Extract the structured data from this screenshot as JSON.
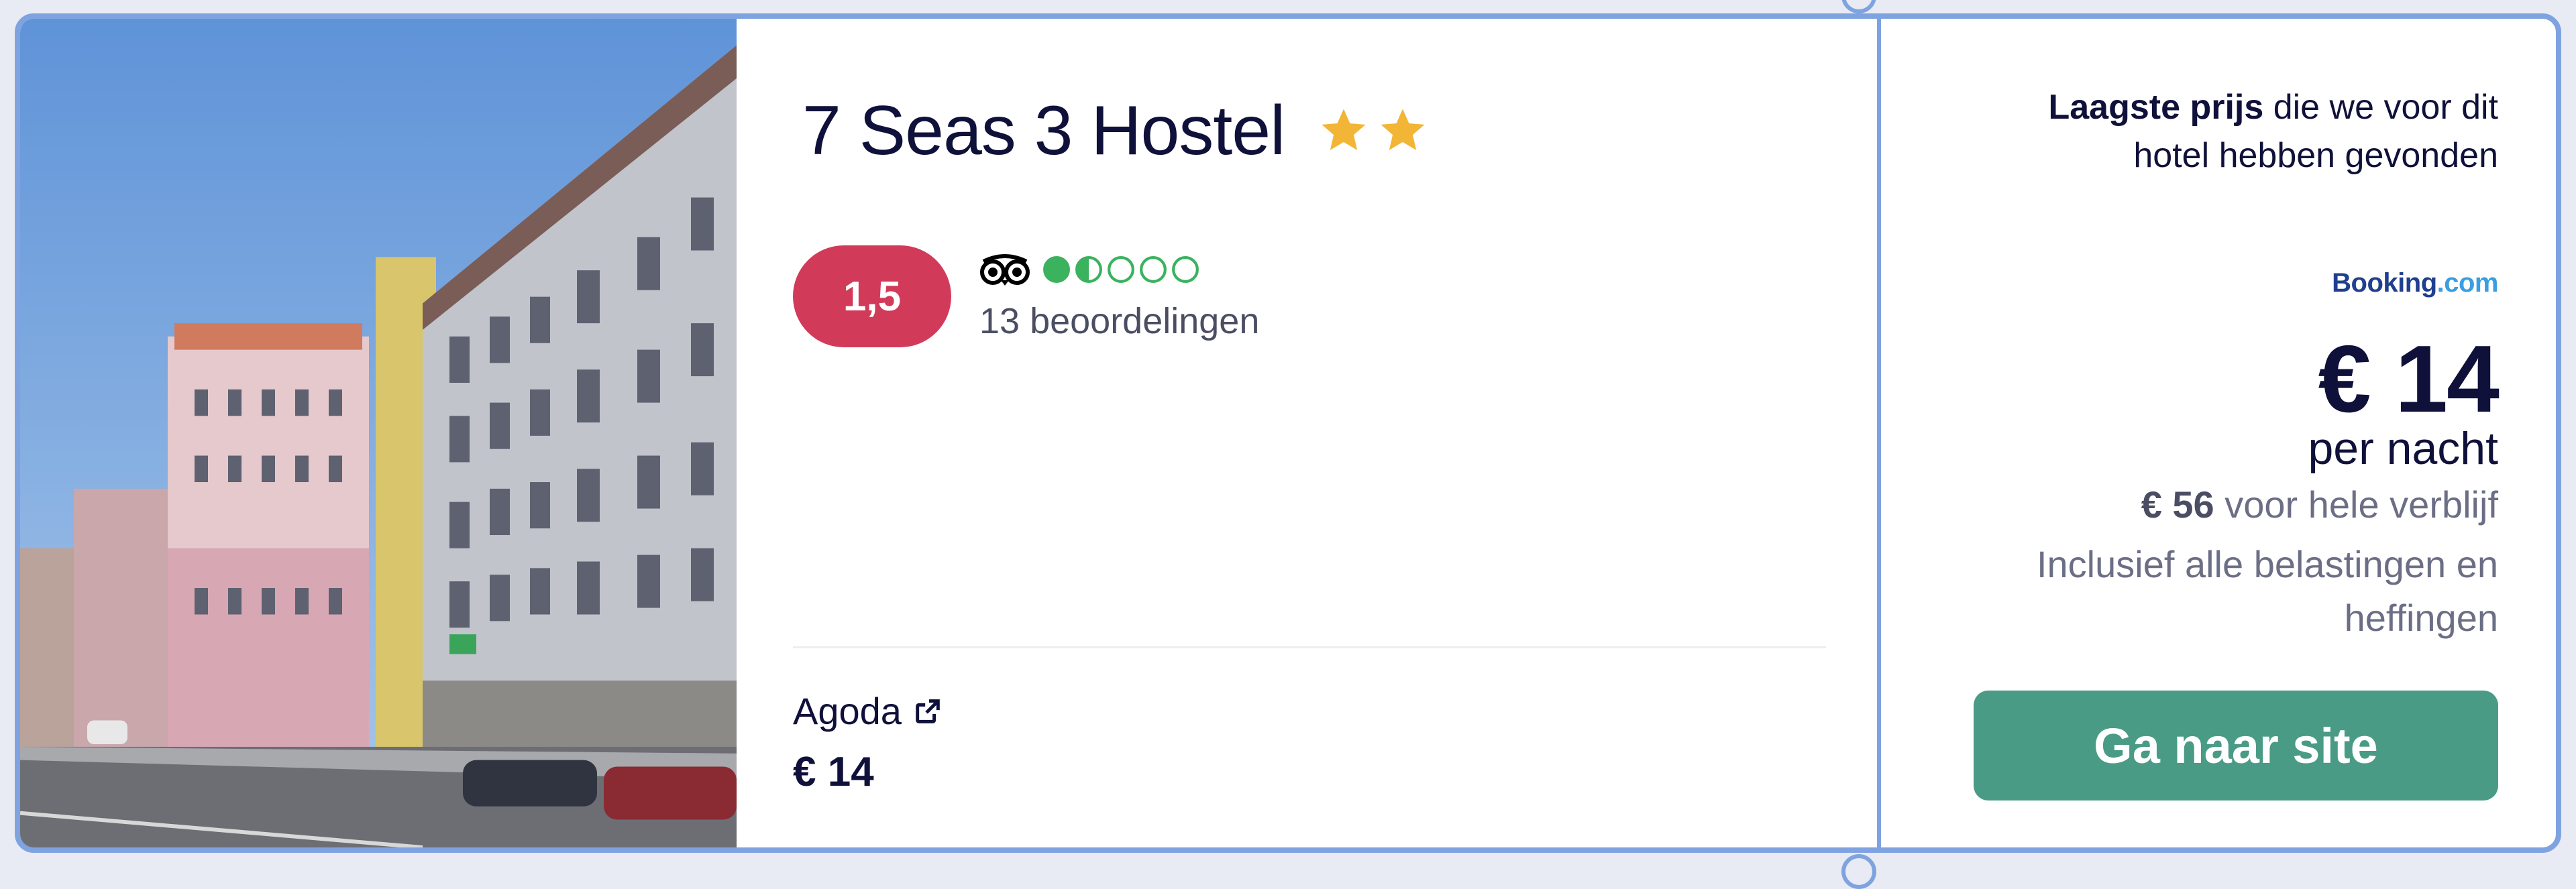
{
  "hotel": {
    "name": "7 Seas 3 Hostel",
    "star_count": 2,
    "rating_score": "1,5",
    "tripadvisor": {
      "icon": "tripadvisor-owl-icon",
      "filled_bubbles": 1.5,
      "total_bubbles": 5,
      "color": "#3ab25e"
    },
    "reviews_text": "13 beoordelingen"
  },
  "provider": {
    "name": "Agoda",
    "price": "€ 14",
    "icon": "external-link-icon"
  },
  "price_panel": {
    "lowest_bold": "Laagste prijs",
    "lowest_rest": " die we voor dit hotel hebben gevonden",
    "source_logo_main": "Booking",
    "source_logo_suffix": ".com",
    "price": "€ 14",
    "per_night": "per nacht",
    "total_bold": "€ 56",
    "total_rest": " voor hele verblijf",
    "taxes": "Inclusief alle belastingen en heffingen",
    "cta_label": "Ga naar site"
  },
  "colors": {
    "accent": "#4a9b85",
    "rating_badge": "#d23a5a",
    "star": "#f2b535",
    "border": "#7ea3e0"
  }
}
